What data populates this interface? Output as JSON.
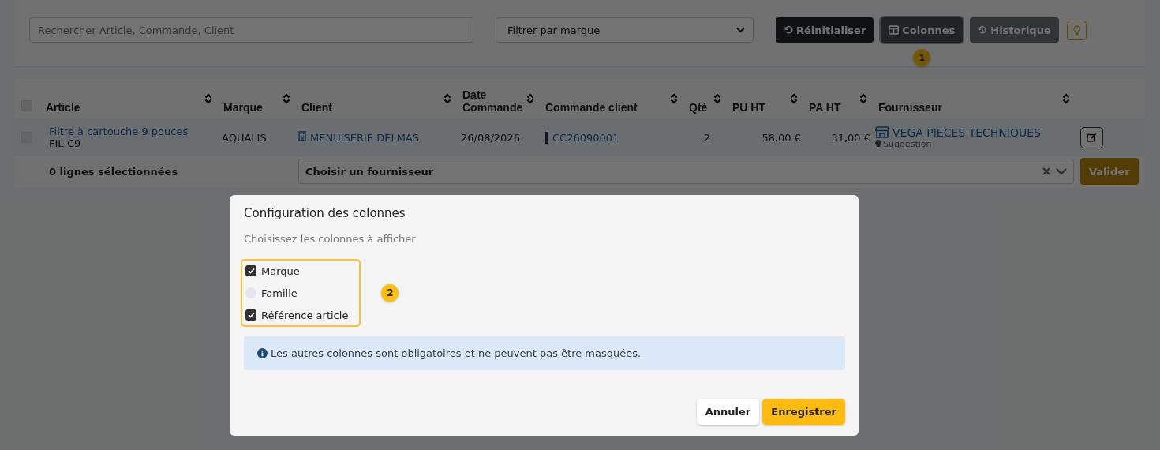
{
  "toolbar": {
    "search": {
      "placeholder": "Rechercher Article, Commande, Client"
    },
    "brand_filter": {
      "value": "Filtrer par marque"
    },
    "buttons": [
      {
        "kind": "reset",
        "label": "Réinitialiser",
        "selected": false
      },
      {
        "kind": "columns",
        "label": "Colonnes",
        "selected": true
      },
      {
        "kind": "history",
        "label": "Historique",
        "selected": false
      },
      {
        "kind": "hint",
        "selected": false
      }
    ],
    "callout": "1"
  },
  "table": {
    "select_all": {
      "checked": false
    },
    "columns": [
      {
        "label": "Article",
        "sortable": true
      },
      {
        "label": "Marque",
        "sortable": true
      },
      {
        "label": "Client",
        "sortable": true
      },
      {
        "label": "Date Commande",
        "sortable": true
      },
      {
        "label": "Commande client",
        "sortable": true
      },
      {
        "label": "Qté",
        "sortable": true
      },
      {
        "label": "PU HT",
        "sortable": true
      },
      {
        "label": "PA HT",
        "sortable": true
      },
      {
        "label": "Fournisseur",
        "sortable": true
      }
    ],
    "rows": [
      {
        "checked": false,
        "article": "Filtre à cartouche 9 pouces",
        "reference": "FIL-C9",
        "brand": "AQUALIS",
        "client": "MENUISERIE DELMAS",
        "order_date": "26/08/2026",
        "customer_order": "CC26090001",
        "quantity": "2",
        "unit_price": "58,00 €",
        "purchase_price": "31,00 €",
        "supplier": "VEGA PIECES TECHNIQUES",
        "supplier_note": "Suggestion"
      }
    ],
    "footer": {
      "selected_count": "0 lignes sélectionnées",
      "supplier_select": {
        "placeholder": "Choisir un fournisseur"
      },
      "validate_button": {
        "label": "Valider",
        "disabled": true
      }
    }
  },
  "dialog": {
    "title": "Configuration des colonnes",
    "subtitle": "Choisissez les colonnes à afficher",
    "options": [
      {
        "label": "Marque",
        "checked": true
      },
      {
        "label": "Famille",
        "checked": false
      },
      {
        "label": "Référence article",
        "checked": true
      }
    ],
    "callout": "2",
    "info": "Les autres colonnes sont obligatoires et ne peuvent pas être masquées.",
    "buttons": [
      {
        "kind": "secondary",
        "label": "Annuler"
      },
      {
        "kind": "primary",
        "label": "Enregistrer"
      }
    ]
  }
}
